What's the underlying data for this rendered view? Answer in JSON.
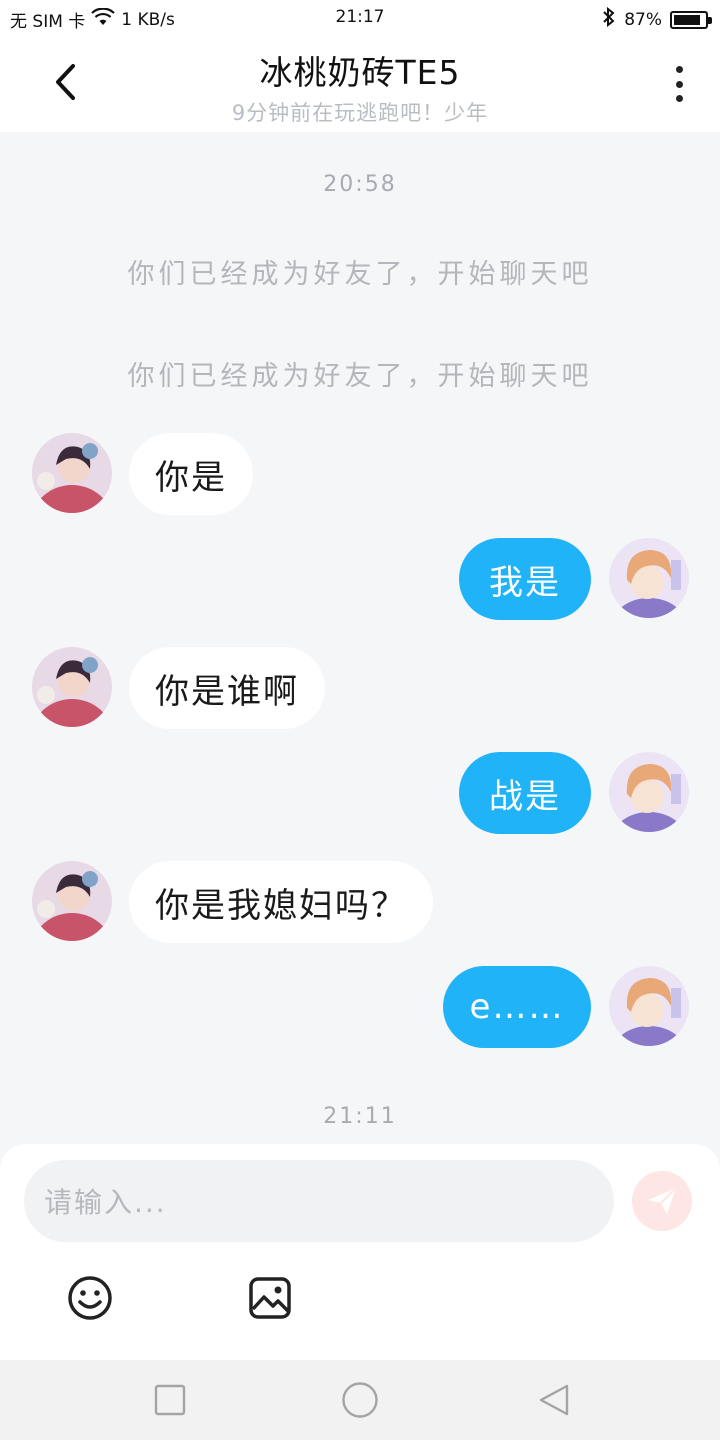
{
  "status_bar": {
    "carrier": "无 SIM 卡",
    "net_speed": "1 KB/s",
    "time": "21:17",
    "battery": "87%",
    "battery_level": 0.87,
    "icons": [
      "wifi-icon",
      "bluetooth-icon",
      "battery-icon"
    ]
  },
  "header": {
    "title": "冰桃奶砖TE5",
    "subtitle": "9分钟前在玩逃跑吧！少年",
    "back_icon": "chevron-left-icon",
    "more_icon": "more-vertical-icon"
  },
  "chat": {
    "timestamps": [
      "20:58",
      "21:11"
    ],
    "system_messages": [
      "你们已经成为好友了，开始聊天吧",
      "你们已经成为好友了，开始聊天吧"
    ],
    "messages": [
      {
        "side": "in",
        "text": "你是"
      },
      {
        "side": "out",
        "text": "我是"
      },
      {
        "side": "in",
        "text": "你是谁啊"
      },
      {
        "side": "out",
        "text": "战是"
      },
      {
        "side": "in",
        "text": "你是我媳妇吗？"
      },
      {
        "side": "out",
        "text": "e……"
      }
    ]
  },
  "input": {
    "placeholder": "请输入...",
    "send_icon": "send-icon",
    "emoji_icon": "emoji-icon",
    "image_icon": "image-icon"
  },
  "nav": {
    "icons": [
      "recent-apps-icon",
      "home-icon",
      "back-icon"
    ]
  },
  "colors": {
    "outgoing_bubble": "#21b3f7",
    "incoming_bubble": "#ffffff",
    "chat_background": "#f5f6f8",
    "send_button": "#fde6e4"
  }
}
